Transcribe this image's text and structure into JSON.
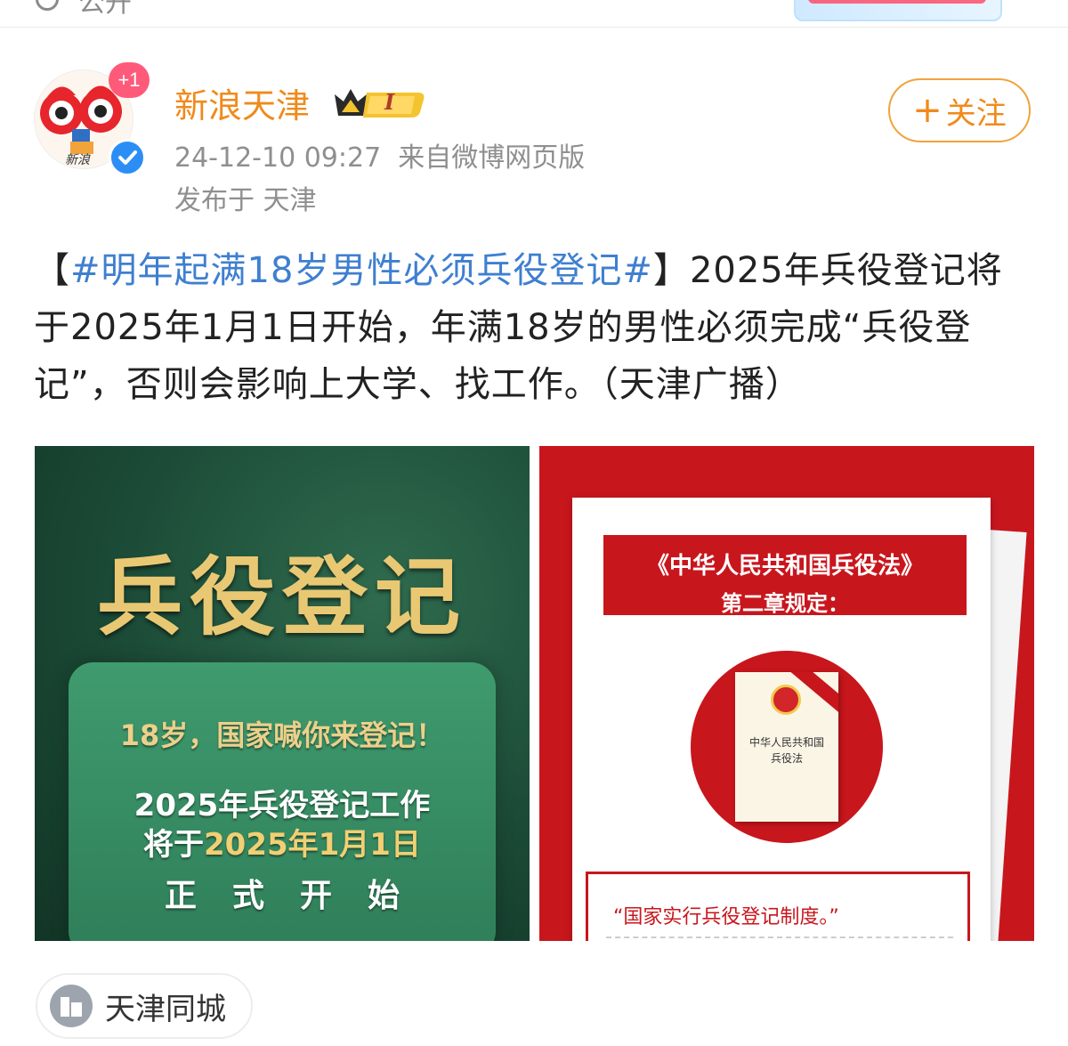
{
  "topbar": {
    "cut_text": "公开"
  },
  "user": {
    "name": "新浪天津",
    "vip_level": "I",
    "avatar_caption": "新浪",
    "follow_badge": "+1",
    "time": "24-12-10 09:27",
    "source": "来自微博网页版",
    "location": "发布于 天津"
  },
  "follow": {
    "plus": "+",
    "label": "关注"
  },
  "post": {
    "bracket_open": "【",
    "hashtag": "#明年起满18岁男性必须兵役登记#",
    "bracket_close": "】",
    "body": "2025年兵役登记将于2025年1月1日开始，年满18岁的男性必须完成“兵役登记”，否则会影响上大学、找工作。（天津广播）"
  },
  "images": {
    "left": {
      "title": "兵役登记",
      "line1": "18岁，国家喊你来登记！",
      "line2": "2025年兵役登记工作",
      "line3_prefix": "将于",
      "line3_highlight": "2025年1月1日",
      "line4": "正式开始"
    },
    "right": {
      "band_line1": "《中华人民共和国兵役法》",
      "band_line2": "第二章规定：",
      "book_title1": "中华人民共和国",
      "book_title2": "兵役法",
      "quote": "“国家实行兵役登记制度。”"
    }
  },
  "city_tag": {
    "label": "天津同城",
    "icon": "building-icon"
  },
  "colors": {
    "accent": "#f08a1b",
    "hashtag": "#3f7fd0",
    "meta": "#8f8f8f",
    "verified": "#2c8ef5",
    "red": "#c8161d",
    "green_dark": "#1b4a36",
    "gold": "#e9c874"
  }
}
